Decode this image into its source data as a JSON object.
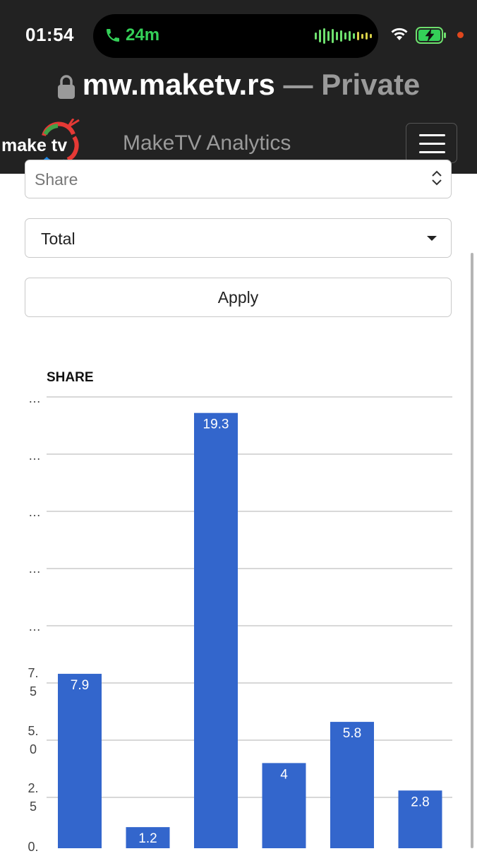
{
  "status": {
    "time": "01:54",
    "call_duration": "24m"
  },
  "browser": {
    "domain": "mw.maketv.rs",
    "separator": " — ",
    "mode": "Private"
  },
  "navbar": {
    "logo_text": "make tv",
    "brand": "MakeTV Analytics",
    "menu_icon": "hamburger-icon"
  },
  "form": {
    "metric_select": {
      "value": "Share"
    },
    "group_select": {
      "value": "Total"
    },
    "apply_label": "Apply"
  },
  "colors": {
    "bar": "#3366cc",
    "header": "#222222",
    "call_green": "#34d058"
  },
  "chart_data": {
    "type": "bar",
    "title": "SHARE",
    "values": [
      7.9,
      1.2,
      19.3,
      4,
      5.8,
      2.8
    ],
    "data_labels": [
      "7.9",
      "1.2",
      "19.3",
      "4",
      "5.8",
      "2.8"
    ],
    "ytick_labels": [
      "0.",
      "2.5",
      "5.0",
      "7.5",
      "…",
      "…",
      "…",
      "…",
      "…"
    ],
    "ylim": [
      0,
      20
    ],
    "grid": true
  }
}
